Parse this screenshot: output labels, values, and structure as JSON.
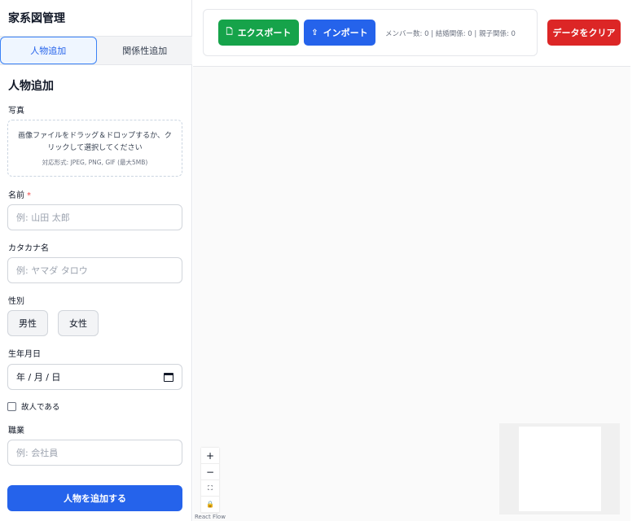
{
  "sidebar": {
    "app_title": "家系図管理",
    "tabs": [
      {
        "label": "人物追加",
        "active": true
      },
      {
        "label": "関係性追加",
        "active": false
      }
    ],
    "section_title": "人物追加",
    "photo": {
      "label": "写真",
      "drop_text": "画像ファイルをドラッグ＆ドロップするか、クリックして選択してください",
      "formats": "対応形式: JPEG, PNG, GIF (最大5MB)"
    },
    "name": {
      "label": "名前",
      "required_mark": "*",
      "placeholder": "例: 山田 太郎"
    },
    "kana": {
      "label": "カタカナ名",
      "placeholder": "例: ヤマダ タロウ"
    },
    "gender": {
      "label": "性別",
      "options": [
        "男性",
        "女性"
      ]
    },
    "birthdate": {
      "label": "生年月日",
      "value": "年 / 月 / 日"
    },
    "deceased": {
      "label": "故人である",
      "checked": false
    },
    "occupation": {
      "label": "職業",
      "placeholder": "例: 会社員"
    },
    "submit_label": "人物を追加する"
  },
  "toolbar": {
    "export_label": "エクスポート",
    "import_label": "インポート",
    "stats": "メンバー数: 0 | 結婚関係: 0 | 親子関係: 0",
    "clear_label": "データをクリア"
  },
  "canvas": {
    "controls": [
      "+",
      "−",
      "⛶",
      "🔒"
    ],
    "attribution": "React Flow"
  },
  "colors": {
    "primary": "#2563eb",
    "success": "#16a34a",
    "danger": "#dc2626",
    "required": "#ef4444"
  },
  "icons": {
    "export": "file-icon",
    "import": "cloud-upload-icon",
    "calendar": "calendar-icon"
  }
}
